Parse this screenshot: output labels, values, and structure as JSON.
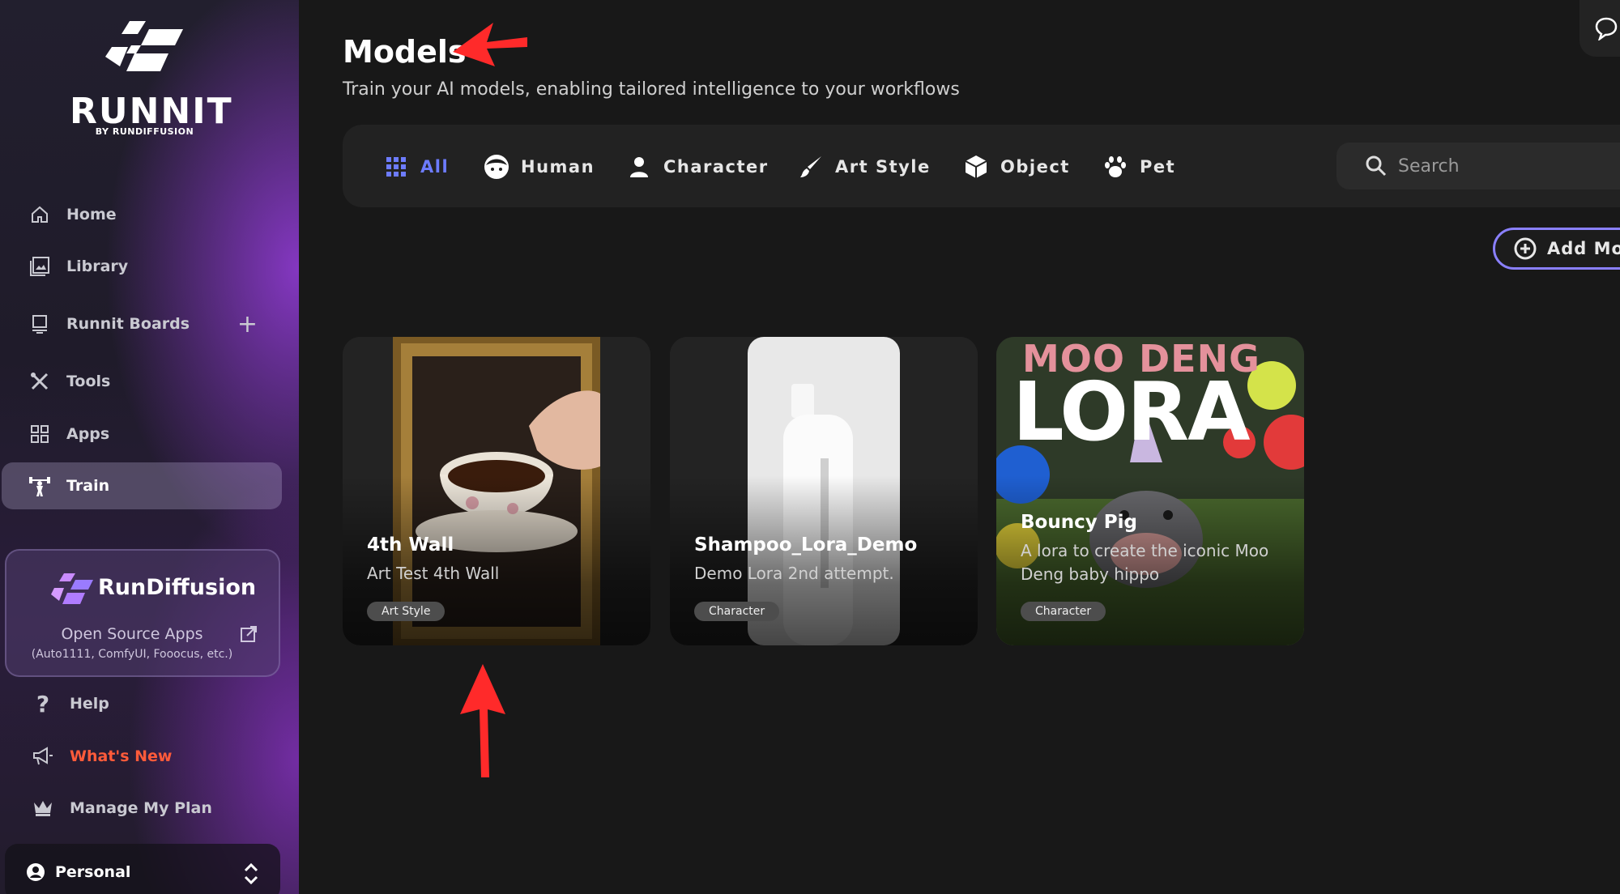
{
  "brand": {
    "name": "RUNNIT",
    "byline": "BY RUNDIFFUSION"
  },
  "sidebar": {
    "items": [
      {
        "label": "Home",
        "icon": "home-icon"
      },
      {
        "label": "Library",
        "icon": "image-icon"
      },
      {
        "label": "Runnit Boards",
        "icon": "board-icon"
      },
      {
        "label": "Tools",
        "icon": "tools-icon"
      },
      {
        "label": "Apps",
        "icon": "grid-icon"
      },
      {
        "label": "Train",
        "icon": "weight-lift-icon",
        "active": true
      }
    ],
    "rundiffusion": {
      "title": "RunDiffusion",
      "apps_label": "Open Source Apps",
      "apps_sub": "(Auto1111, ComfyUI, Fooocus, etc.)"
    },
    "bottom_items": [
      {
        "label": "Help",
        "icon": "question-icon"
      },
      {
        "label": "What's New",
        "icon": "megaphone-icon"
      },
      {
        "label": "Manage My Plan",
        "icon": "crown-icon"
      }
    ],
    "account": {
      "label": "Personal"
    }
  },
  "page": {
    "title": "Models",
    "subtitle": "Train your AI models, enabling tailored intelligence to your workflows"
  },
  "filters": [
    {
      "label": "All",
      "icon": "grid-dots-icon",
      "active": true
    },
    {
      "label": "Human",
      "icon": "human-face-icon"
    },
    {
      "label": "Character",
      "icon": "person-icon"
    },
    {
      "label": "Art Style",
      "icon": "brush-icon"
    },
    {
      "label": "Object",
      "icon": "cube-icon"
    },
    {
      "label": "Pet",
      "icon": "paw-icon"
    }
  ],
  "search": {
    "placeholder": "Search"
  },
  "add_button": {
    "label": "Add Mo"
  },
  "models": [
    {
      "name": "4th Wall",
      "description": "Art Test 4th Wall",
      "tag": "Art Style"
    },
    {
      "name": "Shampoo_Lora_Demo",
      "description": "Demo Lora 2nd attempt.",
      "tag": "Character"
    },
    {
      "name": "Bouncy Pig",
      "description": "A lora to create the iconic Moo Deng baby hippo",
      "tag": "Character",
      "image_text_top": "MOO DENG",
      "image_text_main": "LORA"
    }
  ],
  "colors": {
    "accent": "#6d7cff",
    "annotation_arrow": "#ff2a2a",
    "whats_new": "#ff5b3a"
  }
}
